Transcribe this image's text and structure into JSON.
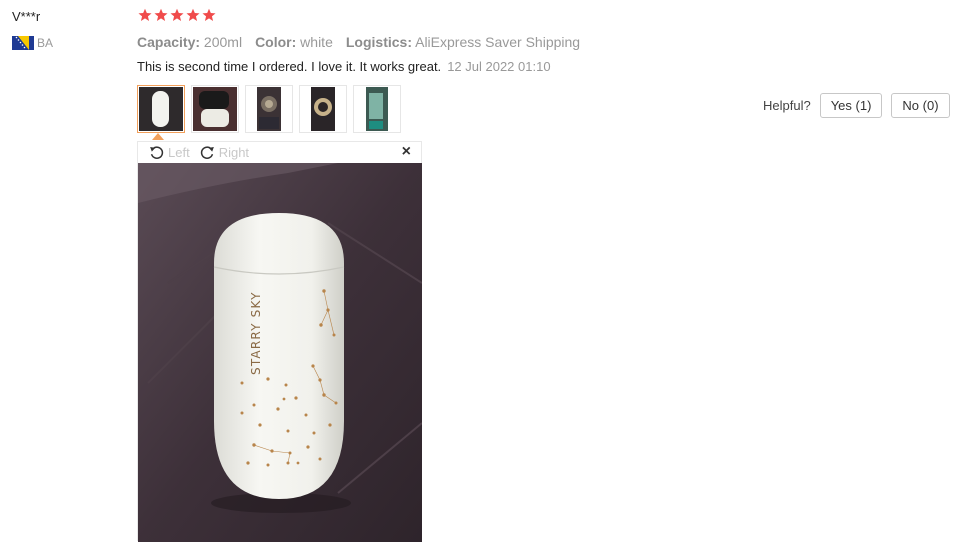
{
  "review": {
    "user_name": "V***r",
    "country_code": "BA",
    "rating_stars": 5,
    "attributes": [
      {
        "name": "Capacity:",
        "value": "200ml"
      },
      {
        "name": "Color:",
        "value": "white"
      },
      {
        "name": "Logistics:",
        "value": "AliExpress Saver Shipping"
      }
    ],
    "text": "This is second time I ordered. I love it. It works great.",
    "date": "12 Jul 2022 01:10"
  },
  "helpful": {
    "label": "Helpful?",
    "yes_label": "Yes (1)",
    "no_label": "No (0)"
  },
  "viewer": {
    "rotate_left_label": "Left",
    "rotate_right_label": "Right",
    "close_symbol": "×",
    "photo_text": "STARRY SKY"
  },
  "colors": {
    "star": "#f04b4b",
    "selected_border": "#f2a05b",
    "muted_text": "#999999"
  },
  "icons": [
    "star-icon",
    "flag-ba-icon",
    "rotate-left-icon",
    "rotate-right-icon",
    "close-icon"
  ]
}
